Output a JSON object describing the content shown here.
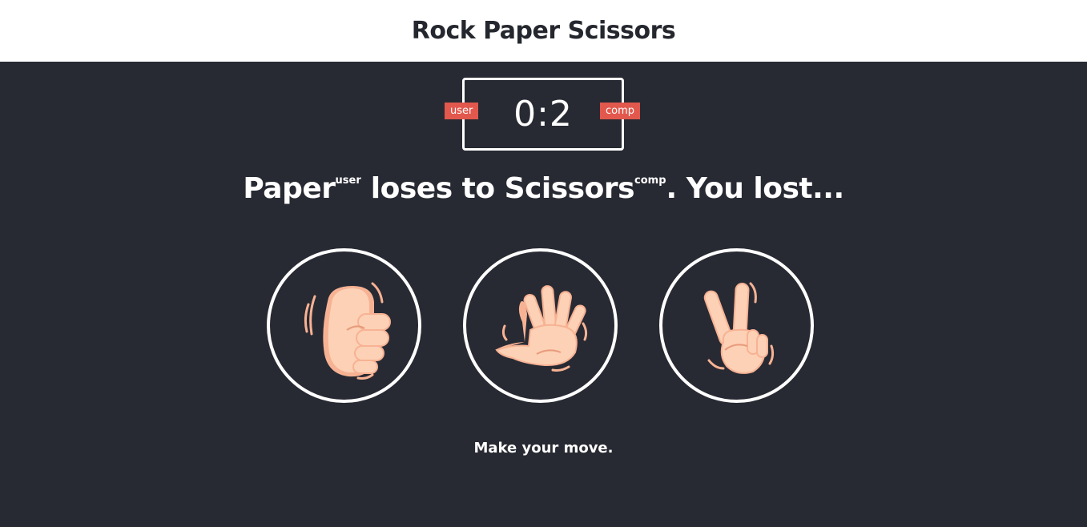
{
  "header": {
    "title": "Rock Paper Scissors"
  },
  "scoreboard": {
    "score": "0:2",
    "user_label": "user",
    "comp_label": "comp"
  },
  "result": {
    "user_choice": "Paper",
    "user_tag": "user",
    "verb": " loses to ",
    "comp_choice": "Scissors",
    "comp_tag": "comp",
    "outcome": ". You lost..."
  },
  "choices": [
    {
      "name": "rock",
      "icon": "rock-hand-icon"
    },
    {
      "name": "paper",
      "icon": "paper-hand-icon"
    },
    {
      "name": "scissors",
      "icon": "scissors-hand-icon"
    }
  ],
  "prompt": "Make your move.",
  "colors": {
    "background": "#282a33",
    "accent": "#e2584d",
    "skin": "#fdd1b5",
    "skin_shadow": "#f7b294",
    "outline": "#ffffff"
  }
}
